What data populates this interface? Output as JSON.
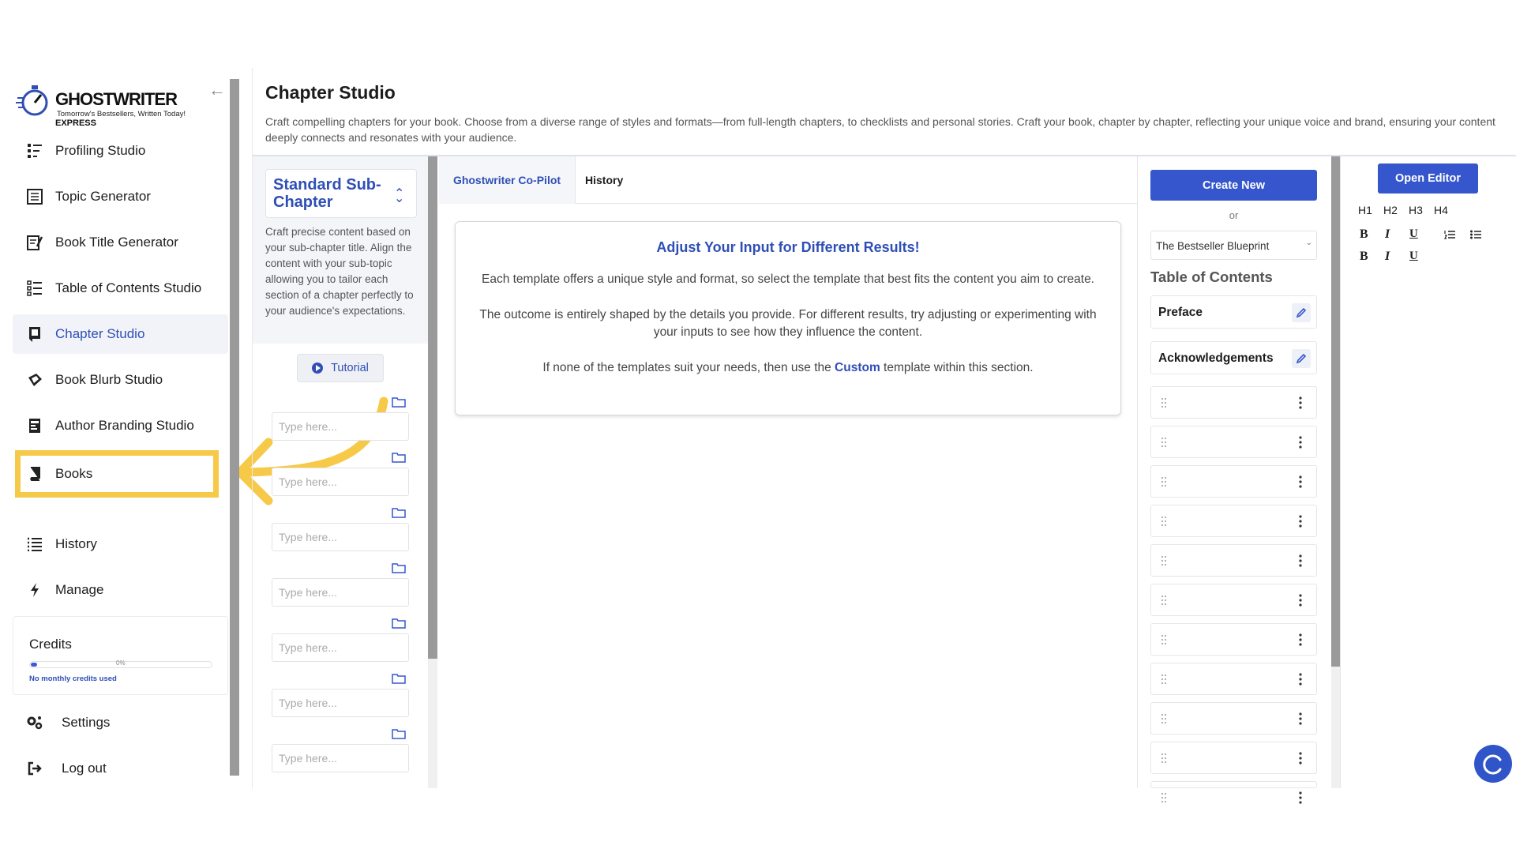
{
  "brand": {
    "name": "GHOSTWRITER",
    "suffix": "EXPRESS",
    "tagline": "Tomorrow's Bestsellers, Written Today!"
  },
  "sidebar": {
    "items": [
      {
        "label": "Profiling Studio",
        "icon": "profiling-icon"
      },
      {
        "label": "Topic Generator",
        "icon": "topic-icon"
      },
      {
        "label": "Book Title Generator",
        "icon": "title-icon"
      },
      {
        "label": "Table of Contents Studio",
        "icon": "toc-icon"
      },
      {
        "label": "Chapter Studio",
        "icon": "chapter-icon",
        "active": true
      },
      {
        "label": "Book Blurb Studio",
        "icon": "blurb-icon"
      },
      {
        "label": "Author Branding Studio",
        "icon": "branding-icon"
      },
      {
        "label": "Books",
        "icon": "book-icon"
      },
      {
        "label": "History",
        "icon": "list-icon"
      },
      {
        "label": "Manage",
        "icon": "bolt-icon"
      },
      {
        "label": "Settings",
        "icon": "gears-icon"
      },
      {
        "label": "Log out",
        "icon": "logout-icon"
      }
    ],
    "credits": {
      "title": "Credits",
      "percent_label": "0%",
      "used_fraction": 0,
      "note": "No monthly credits used"
    }
  },
  "header": {
    "title": "Chapter Studio",
    "description": "Craft compelling chapters for your book. Choose from a diverse range of styles and formats—from full-length chapters, to checklists and personal stories. Craft your book, chapter by chapter, reflecting your unique voice and brand, ensuring your content deeply connects and resonates with your audience."
  },
  "template": {
    "selected": "Standard Sub-Chapter",
    "description": "Craft precise content based on your sub-chapter title. Align the content with your sub-topic allowing you to tailor each section of a chapter perfectly to your audience's expectations.",
    "tutorial_label": "Tutorial",
    "field_placeholder": "Type here..."
  },
  "tabs": [
    {
      "label": "Ghostwriter Co-Pilot",
      "active": true
    },
    {
      "label": "History"
    }
  ],
  "info": {
    "heading": "Adjust Your Input for Different Results!",
    "p1": "Each template offers a unique style and format, so select the template that best fits the content you aim to create.",
    "p2": "The outcome is entirely shaped by the details you provide. For different results, try adjusting or experimenting with your inputs to see how they influence the content.",
    "p3_before": "If none of the templates suit your needs, then use the ",
    "p3_link": "Custom",
    "p3_after": " template within this section."
  },
  "toc": {
    "create_new": "Create New",
    "or": "or",
    "blueprint": "The Bestseller Blueprint",
    "title": "Table of Contents",
    "rows": [
      "Preface",
      "Acknowledgements"
    ]
  },
  "editor": {
    "open_label": "Open Editor",
    "headings": [
      "H1",
      "H2",
      "H3",
      "H4"
    ],
    "bold": "B",
    "italic": "I",
    "underline": "U"
  },
  "colors": {
    "accent": "#3556cc",
    "highlight": "#f7c948"
  }
}
